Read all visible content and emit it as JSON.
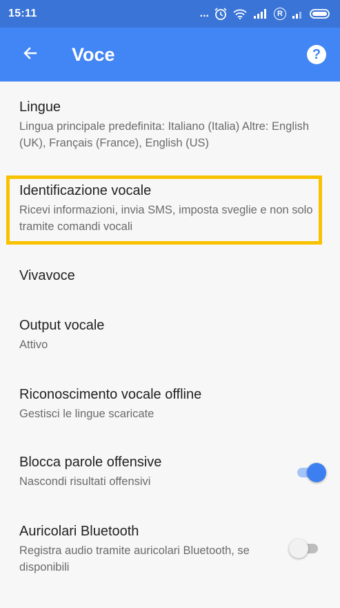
{
  "status_bar": {
    "time": "15:11",
    "icons": [
      "more-dots-icon",
      "alarm-icon",
      "wifi-icon",
      "signal-icon",
      "roaming-icon",
      "signal-icon-2",
      "battery-icon"
    ],
    "dots": "...",
    "roaming": "R"
  },
  "app_bar": {
    "title": "Voce",
    "back_icon": "arrow-back-icon",
    "help_icon": "help-icon",
    "help_glyph": "?",
    "color": "#4285f4"
  },
  "settings": [
    {
      "title": "Lingue",
      "summary": "Lingua principale predefinita: Italiano (Italia) Altre: English (UK), Français (France), English (US)"
    },
    {
      "title": "Identificazione vocale",
      "summary": "Ricevi informazioni, invia SMS, imposta sveglie e non solo tramite comandi vocali",
      "highlighted": true
    },
    {
      "title": "Vivavoce"
    },
    {
      "title": "Output vocale",
      "summary": "Attivo"
    },
    {
      "title": "Riconoscimento vocale offline",
      "summary": "Gestisci le lingue scaricate"
    },
    {
      "title": "Blocca parole offensive",
      "summary": "Nascondi risultati offensivi",
      "toggle": true
    },
    {
      "title": "Auricolari Bluetooth",
      "summary": "Registra audio tramite auricolari Bluetooth, se disponibili",
      "toggle": false
    }
  ],
  "highlight_color": "#f8c200",
  "toggle_on_color": "#3d7ff0"
}
